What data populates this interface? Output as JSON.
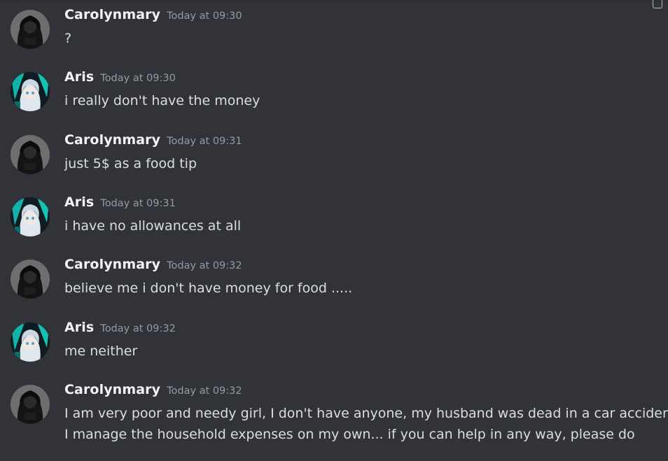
{
  "messages": [
    {
      "author": "Carolynmary",
      "avatar": "dark-haired-girl-avatar",
      "timestamp": "Today at 09:30",
      "lines": [
        "?"
      ]
    },
    {
      "author": "Aris",
      "avatar": "anime-silver-hair-avatar",
      "timestamp": "Today at 09:30",
      "lines": [
        "i really don't have the money"
      ]
    },
    {
      "author": "Carolynmary",
      "avatar": "dark-haired-girl-avatar",
      "timestamp": "Today at 09:31",
      "lines": [
        "just 5$ as a food tip"
      ]
    },
    {
      "author": "Aris",
      "avatar": "anime-silver-hair-avatar",
      "timestamp": "Today at 09:31",
      "lines": [
        "i have no allowances at all"
      ]
    },
    {
      "author": "Carolynmary",
      "avatar": "dark-haired-girl-avatar",
      "timestamp": "Today at 09:32",
      "lines": [
        "believe me i don't have money for food ....."
      ]
    },
    {
      "author": "Aris",
      "avatar": "anime-silver-hair-avatar",
      "timestamp": "Today at 09:32",
      "lines": [
        "me neither"
      ]
    },
    {
      "author": "Carolynmary",
      "avatar": "dark-haired-girl-avatar",
      "timestamp": "Today at 09:32",
      "lines": [
        "I am very poor and needy girl, I don't have anyone, my husband was dead in a car accident",
        "I manage the household expenses on my own... if you can help in any way, please do"
      ]
    }
  ],
  "colors": {
    "background": "#313338",
    "username": "#f2f3f5",
    "timestamp": "#949ba4",
    "text": "#dbdee1"
  }
}
